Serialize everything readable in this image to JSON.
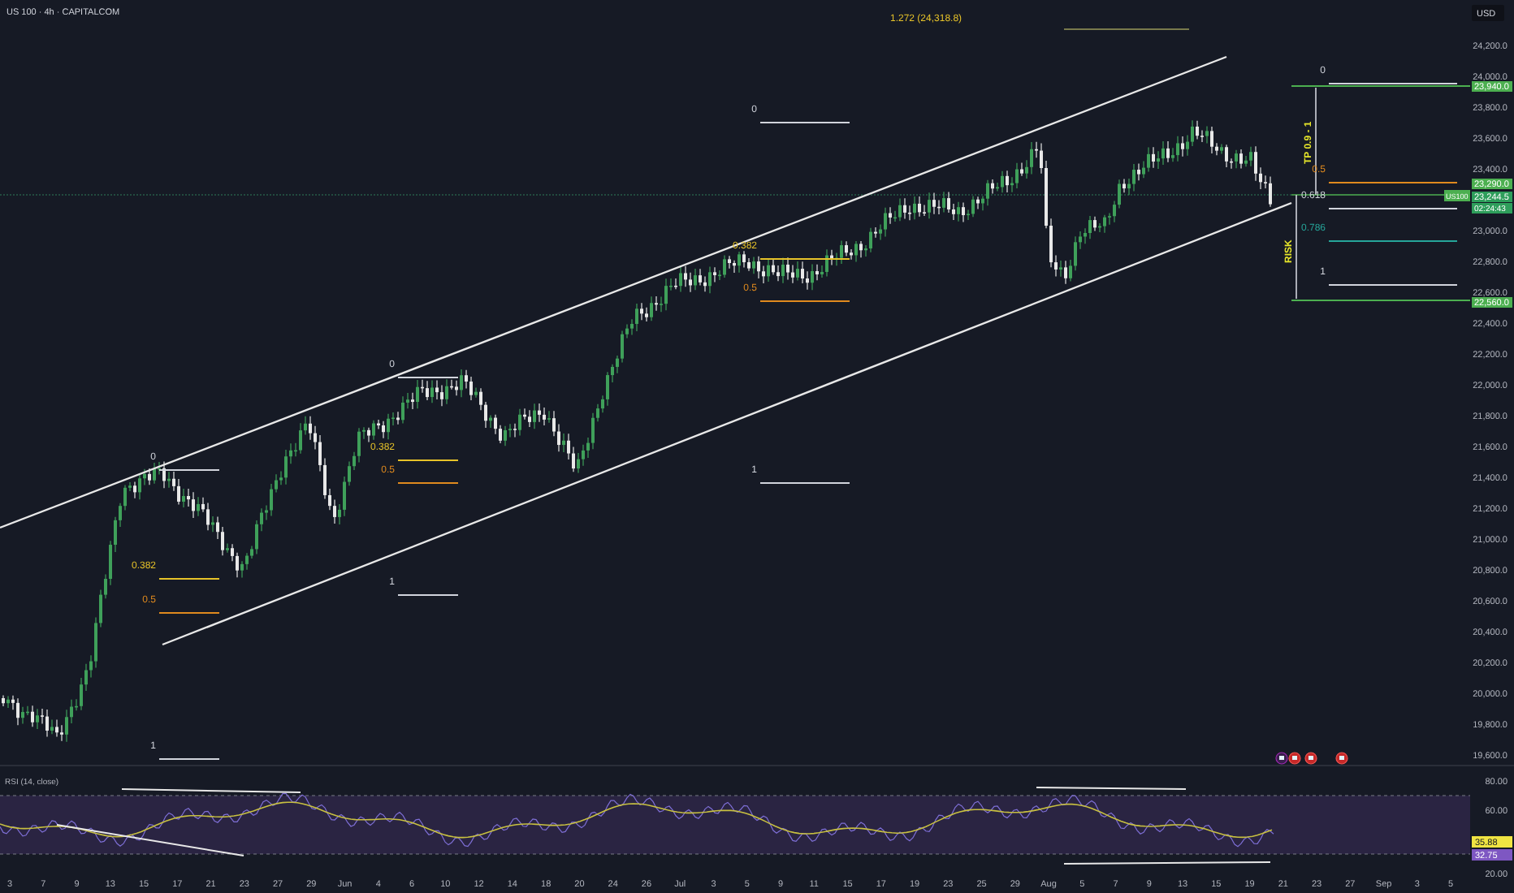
{
  "header": {
    "symbol": "US 100 · 4h · CAPITALCOM",
    "currency": "USD"
  },
  "extension": {
    "label": "1.272 (24,318.8)"
  },
  "fib_retracements": [
    {
      "levels": [
        {
          "label": "0",
          "color": "#d1d4dc"
        },
        {
          "label": "0.382",
          "color": "#e6c229"
        },
        {
          "label": "0.5",
          "color": "#e08a1e"
        },
        {
          "label": "1",
          "color": "#d1d4dc"
        }
      ]
    },
    {
      "levels": [
        {
          "label": "0",
          "color": "#d1d4dc"
        },
        {
          "label": "0.382",
          "color": "#e6c229"
        },
        {
          "label": "0.5",
          "color": "#e08a1e"
        },
        {
          "label": "1",
          "color": "#d1d4dc"
        }
      ]
    },
    {
      "levels": [
        {
          "label": "0",
          "color": "#d1d4dc"
        },
        {
          "label": "0.382",
          "color": "#e6c229"
        },
        {
          "label": "0.5",
          "color": "#e08a1e"
        },
        {
          "label": "1",
          "color": "#d1d4dc"
        }
      ]
    }
  ],
  "trade_setup": {
    "target_label": "TP 0.9 - 1",
    "risk_label": "RISK",
    "levels": [
      {
        "label": "0",
        "color": "#d1d4dc"
      },
      {
        "label": "0.5",
        "color": "#e08a1e"
      },
      {
        "label": "0.618",
        "color": "#d1d4dc"
      },
      {
        "label": "0.786",
        "color": "#26a69a"
      },
      {
        "label": "1",
        "color": "#d1d4dc"
      }
    ]
  },
  "price_axis": {
    "ticks": [
      "24,200.0",
      "24,000.0",
      "23,800.0",
      "23,600.0",
      "23,400.0",
      "23,000.0",
      "22,800.0",
      "22,600.0",
      "22,400.0",
      "22,200.0",
      "22,000.0",
      "21,800.0",
      "21,600.0",
      "21,400.0",
      "21,200.0",
      "21,000.0",
      "20,800.0",
      "20,600.0",
      "20,400.0",
      "20,200.0",
      "20,000.0",
      "19,800.0",
      "19,600.0"
    ],
    "symbol_tag": "US100",
    "tags": [
      {
        "text": "23,940.0",
        "kind": "level"
      },
      {
        "text": "23,290.0",
        "kind": "level"
      },
      {
        "text": "23,244.5",
        "kind": "last"
      },
      {
        "text": "02:24:43",
        "kind": "countdown"
      },
      {
        "text": "22,560.0",
        "kind": "level"
      }
    ]
  },
  "rsi": {
    "title": "RSI (14, close)",
    "ticks": [
      "80.00",
      "60.00",
      "20.00"
    ],
    "ma_value": "35.88",
    "rsi_value": "32.75"
  },
  "time_axis": {
    "ticks": [
      "3",
      "7",
      "9",
      "13",
      "15",
      "17",
      "21",
      "23",
      "27",
      "29",
      "Jun",
      "4",
      "6",
      "10",
      "12",
      "14",
      "18",
      "20",
      "24",
      "26",
      "Jul",
      "3",
      "5",
      "9",
      "11",
      "15",
      "17",
      "19",
      "23",
      "25",
      "29",
      "Aug",
      "5",
      "7",
      "9",
      "13",
      "15",
      "19",
      "21",
      "23",
      "27",
      "Sep",
      "3",
      "5"
    ]
  }
}
